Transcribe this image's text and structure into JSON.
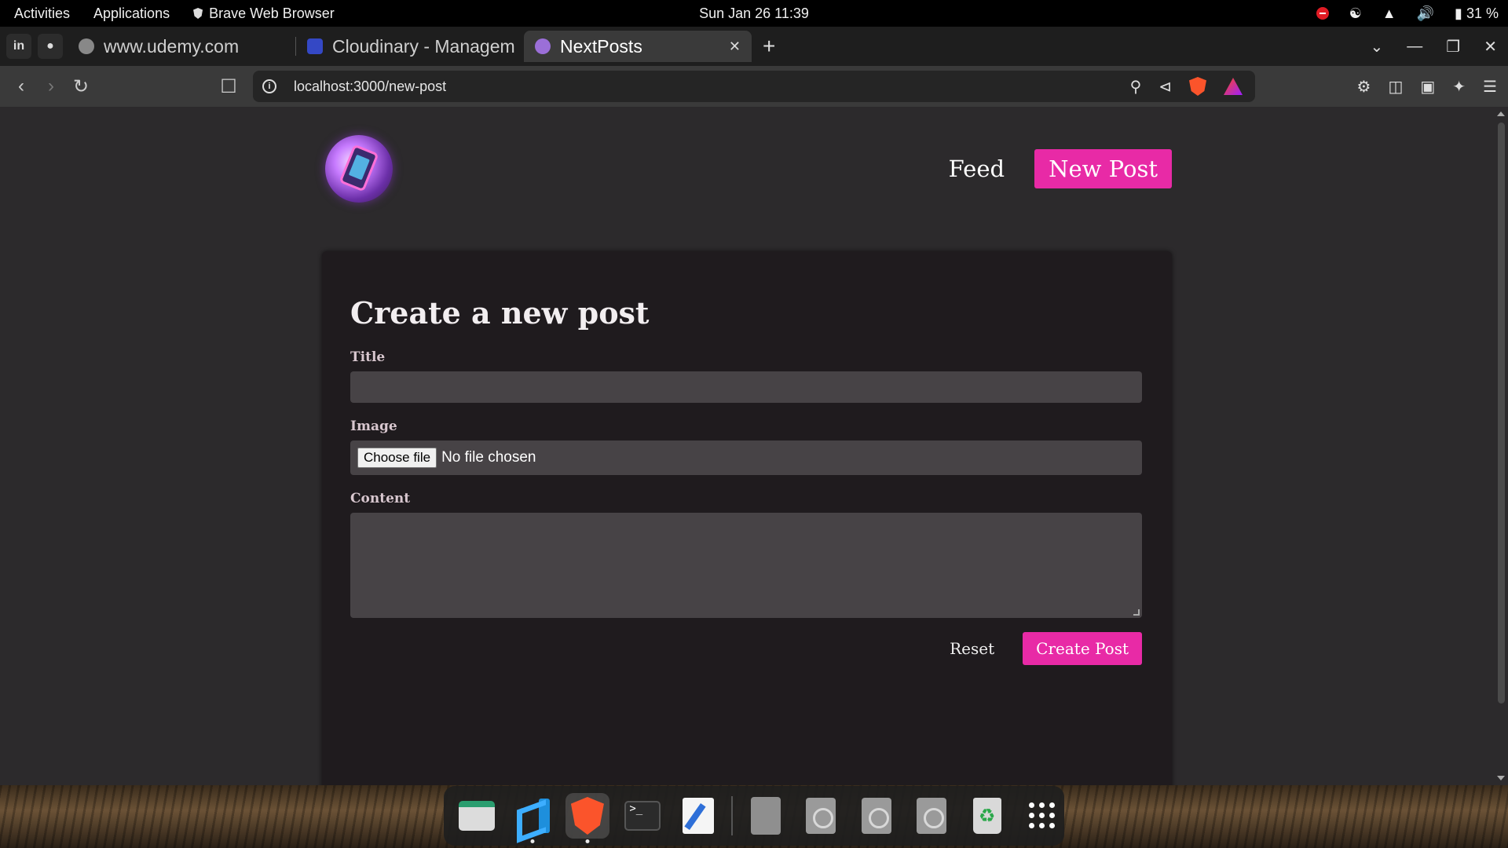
{
  "topbar": {
    "activities": "Activities",
    "applications": "Applications",
    "focused_app": "Brave Web Browser",
    "clock": "Sun Jan 26  11:39",
    "battery": "31 %"
  },
  "tabs": [
    {
      "title": "www.udemy.com"
    },
    {
      "title": "Cloudinary - Managem"
    },
    {
      "title": "NextPosts",
      "active": true
    }
  ],
  "address": {
    "url": "localhost:3000/new-post",
    "rewards_badge": "1"
  },
  "site": {
    "nav_feed": "Feed",
    "nav_new_post": "New Post"
  },
  "form": {
    "heading": "Create a new post",
    "title_label": "Title",
    "title_value": "",
    "image_label": "Image",
    "choose_file_label": "Choose file",
    "no_file_text": "No file chosen",
    "content_label": "Content",
    "content_value": "",
    "reset_label": "Reset",
    "submit_label": "Create Post"
  },
  "dock": {
    "apps": [
      "files-icon",
      "vscode-icon",
      "brave-icon",
      "terminal-icon",
      "text-editor-icon",
      "archive-icon",
      "disc-icon",
      "disc-icon",
      "disc-icon",
      "trash-icon",
      "app-grid-icon"
    ]
  },
  "colors": {
    "accent": "#e82aa6",
    "page_bg": "#2c2a2c",
    "card_bg": "#1f1b1e",
    "input_bg": "#474346"
  }
}
